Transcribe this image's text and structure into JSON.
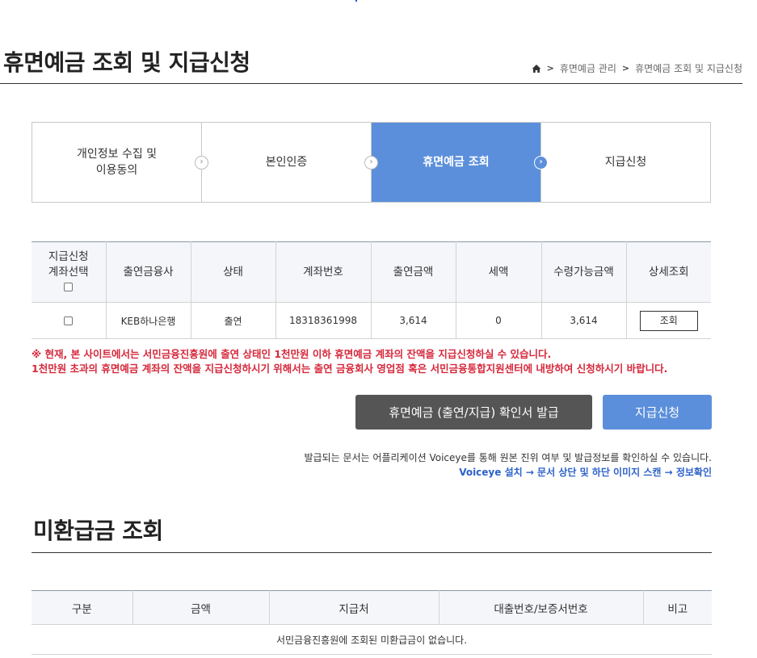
{
  "header": {
    "title": "휴면예금 조회 및 지급신청",
    "breadcrumb": [
      "휴면예금 관리",
      "휴면예금 조회 및 지급신청"
    ],
    "breadcrumb_sep": ">"
  },
  "steps": [
    {
      "label": "개인정보 수집 및\n이용동의",
      "active": false
    },
    {
      "label": "본인인증",
      "active": false
    },
    {
      "label": "휴면예금 조회",
      "active": true
    },
    {
      "label": "지급신청",
      "active": false
    }
  ],
  "accounts": {
    "headers": [
      "지급신청\n계좌선택",
      "출연금융사",
      "상태",
      "계좌번호",
      "출연금액",
      "세액",
      "수령가능금액",
      "상세조회"
    ],
    "rows": [
      {
        "institution": "KEB하나은행",
        "status": "출연",
        "account_no": "18318361998",
        "amount": "3,614",
        "tax": "0",
        "receivable": "3,614",
        "view_label": "조회"
      }
    ]
  },
  "notice": {
    "line1": "※ 현재, 본 사이트에서는 서민금융진흥원에 출연 상태인 1천만원 이하 휴면예금 계좌의 잔액을 지급신청하실 수 있습니다.",
    "line2": "1천만원 초과의 휴면예금 계좌의 잔액을 지급신청하시기 위해서는 출연 금융회사 영업점 혹은 서민금융통합지원센터에 내방하여 신청하시기 바랍니다."
  },
  "actions": {
    "certificate_label": "휴면예금 (출연/지급) 확인서 발급",
    "apply_label": "지급신청"
  },
  "voiceye": {
    "line1": "발급되는 문서는 어플리케이션 Voiceye를 통해 원본 진위 여부 및 발급정보를 확인하실 수 있습니다.",
    "line2": "Voiceye 설치 → 문서 상단 및 하단 이미지 스캔 → 정보확인"
  },
  "unpaid": {
    "title": "미환급금 조회",
    "headers": [
      "구분",
      "금액",
      "지급처",
      "대출번호/보증서번호",
      "비고"
    ],
    "empty_message": "서민금융진흥원에 조회된 미환급금이 없습니다."
  },
  "colors": {
    "accent": "#5b8fdb",
    "dark_button": "#555555",
    "notice_red": "#d6283b",
    "link_blue": "#2d62c8"
  }
}
